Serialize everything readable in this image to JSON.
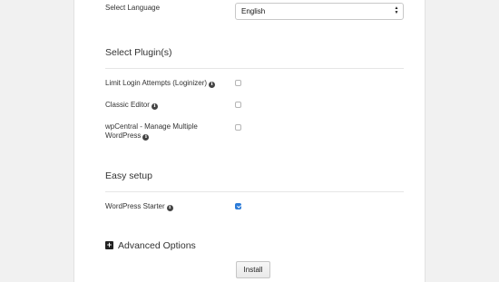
{
  "language": {
    "label": "Select Language",
    "selected": "English"
  },
  "plugins": {
    "title": "Select Plugin(s)",
    "items": [
      {
        "label": "Limit Login Attempts (Loginizer)",
        "checked": false
      },
      {
        "label": "Classic Editor",
        "checked": false
      },
      {
        "label_line1": "wpCentral - Manage Multiple",
        "label_line2": "WordPress",
        "checked": false
      }
    ]
  },
  "easy_setup": {
    "title": "Easy setup",
    "items": [
      {
        "label": "WordPress Starter",
        "checked": true
      }
    ]
  },
  "advanced": {
    "label": "Advanced Options",
    "icon": "plus-square-icon"
  },
  "install": {
    "label": "Install"
  }
}
